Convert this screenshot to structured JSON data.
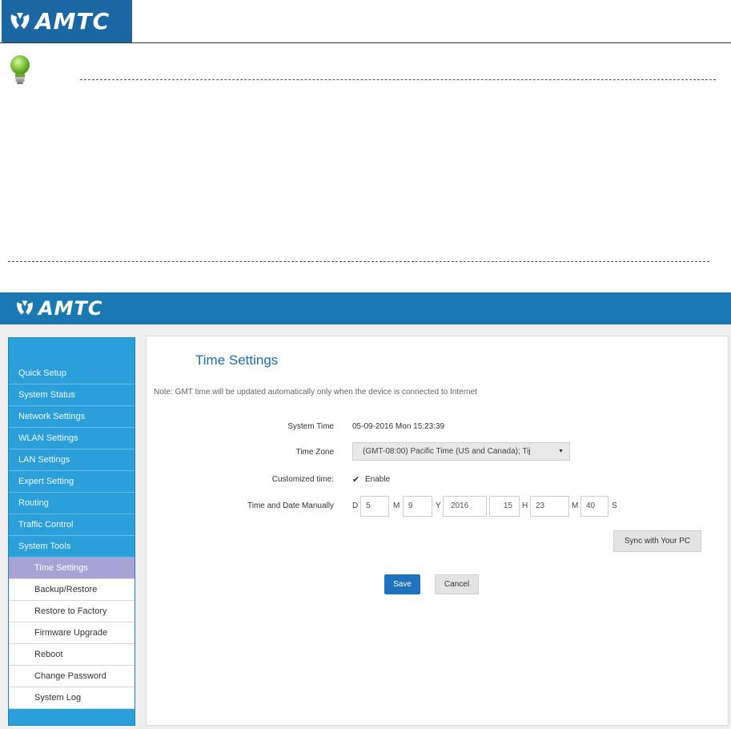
{
  "document": {
    "logo_text": "AMTC"
  },
  "router_ui": {
    "header": {
      "logo_text": "AMTC"
    },
    "sidebar": {
      "items": [
        {
          "label": "Quick Setup"
        },
        {
          "label": "System Status"
        },
        {
          "label": "Network Settings"
        },
        {
          "label": "WLAN Settings"
        },
        {
          "label": "LAN Settings"
        },
        {
          "label": "Expert Setting"
        },
        {
          "label": "Routing"
        },
        {
          "label": "Traffic Control"
        },
        {
          "label": "System Tools"
        }
      ],
      "subitems": [
        {
          "label": "Time Settings",
          "active": true
        },
        {
          "label": "Backup/Restore"
        },
        {
          "label": "Restore to Factory"
        },
        {
          "label": "Firmware Upgrade"
        },
        {
          "label": "Reboot"
        },
        {
          "label": "Change Password"
        },
        {
          "label": "System Log"
        }
      ]
    },
    "main": {
      "title": "Time Settings",
      "note": "Note: GMT time will be updated automatically only when the device is connected to Internet",
      "system_time": {
        "label": "System Time",
        "value": "05-09-2016 Mon 15:23:39"
      },
      "time_zone": {
        "label": "Time Zone",
        "selected": "(GMT-08:00) Pacific Time (US and Canada); Tij"
      },
      "customized_time": {
        "label": "Customized time:",
        "checkbox_label": "Enable",
        "checked": true
      },
      "manual": {
        "label": "Time and Date Manually",
        "day_letter": "D",
        "day": "5",
        "month_letter": "M",
        "month": "9",
        "year_letter": "Y",
        "year": "2016",
        "hour": "15",
        "hour_letter": "H",
        "minute": "23",
        "minute_letter": "M",
        "second": "40",
        "second_letter": "S"
      },
      "sync_button": "Sync with Your PC",
      "save_button": "Save",
      "cancel_button": "Cancel"
    }
  },
  "colors": {
    "brand_blue": "#1a78b2",
    "sidebar_blue": "#2b9fd9",
    "active_item": "#a8a3d6",
    "title_blue": "#1a6fb0",
    "save_blue": "#1e73be"
  }
}
